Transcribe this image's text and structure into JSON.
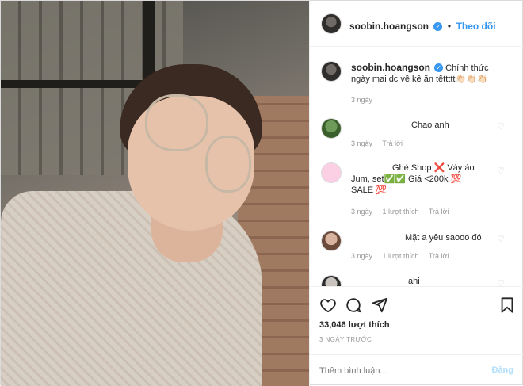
{
  "post": {
    "author": "soobin.hoangson",
    "follow_label": "Theo dõi",
    "caption": {
      "username": "soobin.hoangson",
      "text": "Chính thức ngày mai dc về kê ăn tếttttt👏🏻👏🏻👏🏻",
      "time": "3 ngày"
    },
    "comments": [
      {
        "text": "Chao anh",
        "time": "3 ngày",
        "reply": "Trả lời"
      },
      {
        "text": "Ghé Shop ❌ Váy áo Jum, set✅✅ Giá <200k 💯 SALE 💯",
        "time": "3 ngày",
        "likes": "1 lượt thích",
        "reply": "Trả lời"
      },
      {
        "text": "Mặt a yêu saooo đó",
        "time": "3 ngày",
        "likes": "1 lượt thích",
        "reply": "Trả lời"
      },
      {
        "text": "ahi"
      }
    ],
    "likes_count": "33,046 lượt thích",
    "posted_time": "3 NGÀY TRƯỚC",
    "comment_placeholder": "Thêm bình luận...",
    "post_button": "Đăng"
  },
  "icons": {
    "like": "heart-outline",
    "comment": "speech-bubble",
    "share": "paper-plane",
    "save": "bookmark",
    "verified": "verified-badge"
  },
  "colors": {
    "link": "#3897f0",
    "muted": "#999999",
    "post_disabled": "#b2dffc"
  }
}
